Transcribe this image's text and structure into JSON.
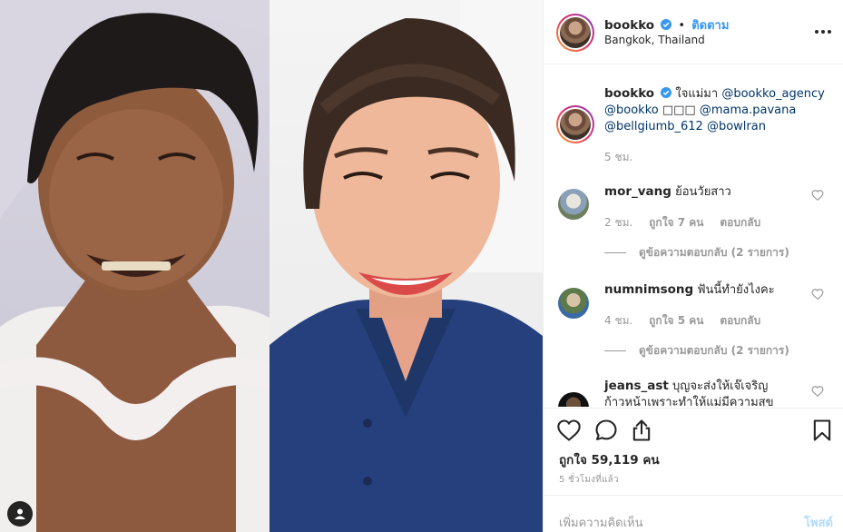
{
  "post": {
    "username": "bookko",
    "follow_label": "ติดตาม",
    "separator": "•",
    "location": "Bangkok, Thailand"
  },
  "caption": {
    "username": "bookko",
    "text": "ใจแม่มา",
    "mention1": "@bookko_agency",
    "mention2": "@bookko",
    "symbols": "□□□",
    "mention3": "@mama.pavana",
    "mention4": "@bellgiumb_612",
    "mention5": "@bowlran",
    "time": "5 ชม."
  },
  "comments": [
    {
      "username": "mor_vang",
      "text": "ย้อนวัยสาว",
      "time": "2 ชม.",
      "likes": "ถูกใจ 7 คน",
      "reply": "ตอบกลับ",
      "view_replies": "ดูข้อความตอบกลับ (2 รายการ)"
    },
    {
      "username": "numnimsong",
      "text": "ฟันนี้ทำยังไงคะ",
      "time": "4 ชม.",
      "likes": "ถูกใจ 5 คน",
      "reply": "ตอบกลับ",
      "view_replies": "ดูข้อความตอบกลับ (2 รายการ)"
    },
    {
      "username": "jeans_ast",
      "text": "บุญจะส่งให้เจ๊เจริญ",
      "text2": "ก้าวหน้าเพราะทำให้แม่มีความสุข"
    }
  ],
  "footer": {
    "likes": "ถูกใจ 59,119 คน",
    "ago": "5 ชั่วโมงที่แล้ว",
    "add_comment_placeholder": "เพิ่มความคิดเห็น",
    "post_label": "โพสต์"
  },
  "colors": {
    "link": "#3897f0",
    "mention": "#003569",
    "muted": "#999999",
    "post_disabled": "#b3dbff"
  },
  "icons": [
    "verified-badge-icon",
    "more-options-icon",
    "heart-icon",
    "comment-icon",
    "share-icon",
    "bookmark-icon",
    "user-tag-icon"
  ]
}
